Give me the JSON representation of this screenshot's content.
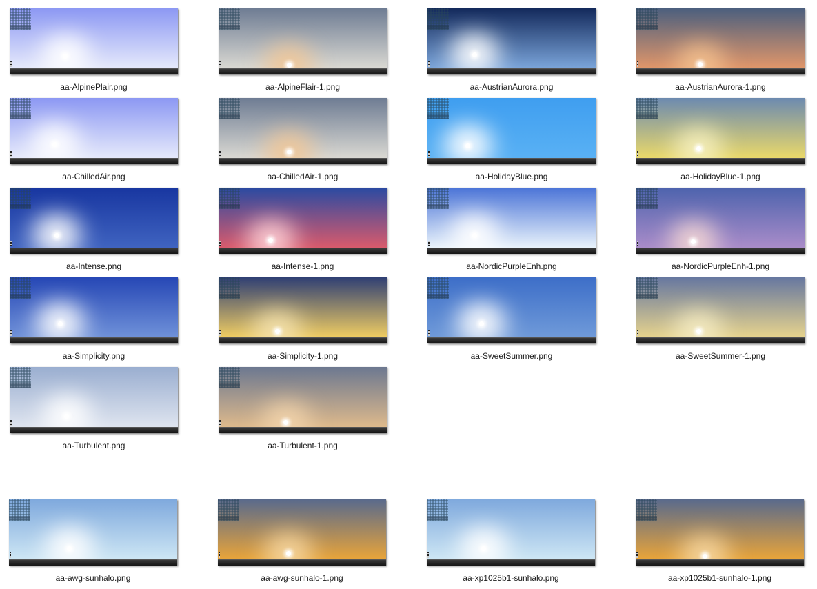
{
  "files": [
    {
      "name": "aa-AlpinePlair.png",
      "sky_top": "#8c98f3",
      "sky_bottom": "#e5e9fb",
      "glow": "#ffffff",
      "sun_x": 0.33,
      "sun_y": 0.72
    },
    {
      "name": "aa-AlpineFlair-1.png",
      "sky_top": "#6e7c93",
      "sky_bottom": "#d9d8d2",
      "glow": "#f2c796",
      "sun_x": 0.42,
      "sun_y": 0.86
    },
    {
      "name": "aa-AustrianAurora.png",
      "sky_top": "#13295b",
      "sky_bottom": "#7aa4d9",
      "glow": "#ffffff",
      "sun_x": 0.28,
      "sun_y": 0.7
    },
    {
      "name": "aa-AustrianAurora-1.png",
      "sky_top": "#4b5f7e",
      "sky_bottom": "#e0966a",
      "glow": "#f3c18f",
      "sun_x": 0.38,
      "sun_y": 0.85
    },
    {
      "name": "aa-ChilledAir.png",
      "sky_top": "#8c98f3",
      "sky_bottom": "#e5e9fb",
      "glow": "#ffffff",
      "sun_x": 0.27,
      "sun_y": 0.7
    },
    {
      "name": "aa-ChilledAir-1.png",
      "sky_top": "#6e7c93",
      "sky_bottom": "#d9d8d2",
      "glow": "#f2c796",
      "sun_x": 0.42,
      "sun_y": 0.82
    },
    {
      "name": "aa-HolidayBlue.png",
      "sky_top": "#3f9ef0",
      "sky_bottom": "#59b1f4",
      "glow": "#ffffff",
      "sun_x": 0.24,
      "sun_y": 0.72
    },
    {
      "name": "aa-HolidayBlue-1.png",
      "sky_top": "#6c8ab0",
      "sky_bottom": "#e9d86a",
      "glow": "#f6f0c0",
      "sun_x": 0.37,
      "sun_y": 0.77
    },
    {
      "name": "aa-Intense.png",
      "sky_top": "#1836a0",
      "sky_bottom": "#3f63c0",
      "glow": "#ffffff",
      "sun_x": 0.28,
      "sun_y": 0.72
    },
    {
      "name": "aa-Intense-1.png",
      "sky_top": "#2a4aa2",
      "sky_bottom": "#d85a6c",
      "glow": "#ffd3d8",
      "sun_x": 0.31,
      "sun_y": 0.8
    },
    {
      "name": "aa-NordicPurpleEnh.png",
      "sky_top": "#4b74d7",
      "sky_bottom": "#e8f2fb",
      "glow": "#ffffff",
      "sun_x": 0.28,
      "sun_y": 0.72
    },
    {
      "name": "aa-NordicPurpleEnh-1.png",
      "sky_top": "#4d63ad",
      "sky_bottom": "#a98cc9",
      "glow": "#f4d7d4",
      "sun_x": 0.34,
      "sun_y": 0.82
    },
    {
      "name": "aa-Simplicity.png",
      "sky_top": "#2647b5",
      "sky_bottom": "#6f91d9",
      "glow": "#ffffff",
      "sun_x": 0.3,
      "sun_y": 0.7
    },
    {
      "name": "aa-Simplicity-1.png",
      "sky_top": "#2f3f74",
      "sky_bottom": "#efcc62",
      "glow": "#f5e3b1",
      "sun_x": 0.35,
      "sun_y": 0.82
    },
    {
      "name": "aa-SweetSummer.png",
      "sky_top": "#3d6ec8",
      "sky_bottom": "#6f9ad9",
      "glow": "#ffffff",
      "sun_x": 0.32,
      "sun_y": 0.7
    },
    {
      "name": "aa-SweetSummer-1.png",
      "sky_top": "#6677a0",
      "sky_bottom": "#e6d38d",
      "glow": "#f5ecc4",
      "sun_x": 0.37,
      "sun_y": 0.82
    },
    {
      "name": "aa-Turbulent.png",
      "sky_top": "#9aaed0",
      "sky_bottom": "#dee4ef",
      "glow": "#ffffff",
      "sun_x": 0.34,
      "sun_y": 0.74
    },
    {
      "name": "aa-Turbulent-1.png",
      "sky_top": "#6c7890",
      "sky_bottom": "#ddb98c",
      "glow": "#f2d4ac",
      "sun_x": 0.4,
      "sun_y": 0.84
    },
    {
      "name": "aa-awg-sunhalo.png",
      "sky_top": "#7fa9dd",
      "sky_bottom": "#cde6f4",
      "glow": "#ffffff",
      "sun_x": 0.36,
      "sun_y": 0.74
    },
    {
      "name": "aa-awg-sunhalo-1.png",
      "sky_top": "#596a8c",
      "sky_bottom": "#e8a43a",
      "glow": "#f6d7a2",
      "sun_x": 0.42,
      "sun_y": 0.82
    },
    {
      "name": "aa-xp1025b1-sunhalo.png",
      "sky_top": "#7fa9dd",
      "sky_bottom": "#cde6f4",
      "glow": "#ffffff",
      "sun_x": 0.34,
      "sun_y": 0.74
    },
    {
      "name": "aa-xp1025b1-sunhalo-1.png",
      "sky_top": "#596a8c",
      "sky_bottom": "#e8a43a",
      "glow": "#f6d7a2",
      "sun_x": 0.41,
      "sun_y": 0.86
    }
  ]
}
